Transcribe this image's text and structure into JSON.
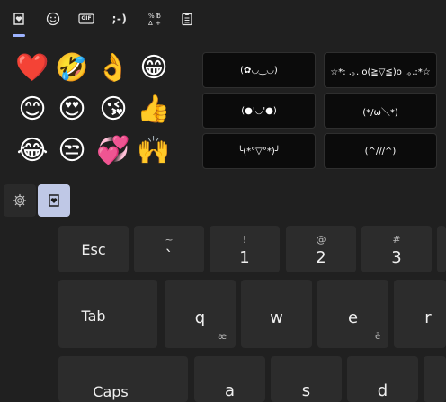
{
  "colors": {
    "background": "#202020",
    "key": "#2c2c2c",
    "kaomoji_tile": "#0b0b0b",
    "accent": "#9db3ff",
    "selected_button": "#bfc8e6"
  },
  "tabs": [
    {
      "name": "favorites-tab",
      "icon": "heart-clipboard-icon",
      "active": true
    },
    {
      "name": "emoji-tab",
      "icon": "smiley-icon",
      "active": false
    },
    {
      "name": "gif-tab",
      "icon": "gif-icon",
      "label": "GIF",
      "active": false
    },
    {
      "name": "kaomoji-tab",
      "icon": "kaomoji-icon",
      "label": ";-)",
      "active": false
    },
    {
      "name": "symbols-tab",
      "icon": "symbols-icon",
      "active": false
    },
    {
      "name": "clipboard-tab",
      "icon": "clipboard-icon",
      "active": false
    }
  ],
  "emojis": [
    "❤️",
    "🤣",
    "👌",
    "😁",
    "😊",
    "😍",
    "😘",
    "👍",
    "😂",
    "😒",
    "💞",
    "🙌"
  ],
  "kaomoji": [
    "(✿◡‿◡)",
    "☆*: .｡. o(≧▽≦)o .｡.:*☆",
    "(●'◡'●)",
    "(*/ω＼*)",
    "╰(*°▽°*)╯",
    "(^///^)"
  ],
  "bottom_buttons": [
    {
      "name": "settings-button",
      "icon": "gear-icon"
    },
    {
      "name": "favorites-button",
      "icon": "heart-clipboard-icon",
      "selected": true
    }
  ],
  "keys": {
    "esc": "Esc",
    "k1": {
      "top": "~",
      "bottom": "`"
    },
    "k2": {
      "top": "!",
      "bottom": "1"
    },
    "k3": {
      "top": "@",
      "bottom": "2"
    },
    "k4": {
      "top": "#",
      "bottom": "3"
    },
    "tab": "Tab",
    "q": {
      "main": "q",
      "alt": "æ"
    },
    "w": {
      "main": "w"
    },
    "e": {
      "main": "e",
      "alt": "ē"
    },
    "r": {
      "main": "r"
    },
    "caps": "Caps",
    "a": "a",
    "s": "s",
    "d": "d"
  }
}
